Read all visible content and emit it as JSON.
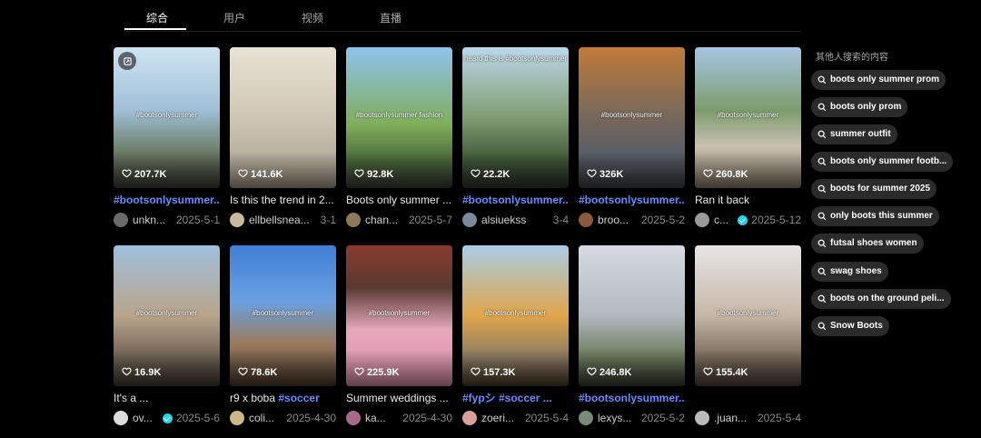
{
  "tabs": [
    "综合",
    "用户",
    "视频",
    "直播"
  ],
  "sidebar": {
    "title": "其他人搜索的内容",
    "suggestions": [
      "boots only summer prom",
      "boots only prom",
      "summer outfit",
      "boots only summer footb...",
      "boots for summer 2025",
      "only boots this summer",
      "futsal shoes women",
      "swag shoes",
      "boots on the ground peli...",
      "Snow Boots"
    ]
  },
  "colors": {
    "accent": "#6b8cff",
    "verified": "#20d5ec",
    "chip_bg": "#2b2b2b"
  },
  "videos": [
    {
      "likes": "207.7K",
      "title": "",
      "tag": "#bootsonlysummer...",
      "author": "unkn...",
      "date": "2025-5-1",
      "caption": "#bootsonlysummer",
      "bg": "linear-gradient(180deg,#cfe4f3 0%,#9fbfd6 45%,#6b7a64 75%,#3b3b33 100%)",
      "avatar": "#6b6b6b"
    },
    {
      "likes": "141.6K",
      "title": "Is this the trend in 2...",
      "tag": "",
      "author": "ellbellsnea...",
      "date": "3-1",
      "caption": "",
      "bg": "linear-gradient(180deg,#e9e3d6 0%,#cfc6b2 50%,#a59c8a 100%)",
      "avatar": "#c9b9a1"
    },
    {
      "likes": "92.8K",
      "title": "Boots only summer ...",
      "tag": "",
      "author": "chan...",
      "date": "2025-5-7",
      "caption": "#bootsonlysummer  fashion",
      "bg": "linear-gradient(180deg,#8fc3ee 0%,#7fae5c 55%,#4c6b3a 80%,#3a3a32 100%)",
      "avatar": "#8d7a5a"
    },
    {
      "likes": "22.2K",
      "title": "",
      "tag": "#bootsonlysummer...",
      "author": "alsiuekss",
      "date": "3-4",
      "caption": "heard this is #bootsonlysummer",
      "bg": "linear-gradient(180deg,#bcd7ea 0%,#7e9c73 50%,#405a36 80%,#2e2e2e 100%)",
      "avatar": "#7a8a9a"
    },
    {
      "likes": "326K",
      "title": "",
      "tag": "#bootsonlysummer...",
      "author": "broo...",
      "date": "2025-5-2",
      "caption": "#bootsonlysummer",
      "bg": "linear-gradient(180deg,#c37a3a 0%,#7c6a58 45%,#5a5e66 75%,#3c3f45 100%)",
      "avatar": "#8a5a3a"
    },
    {
      "likes": "260.8K",
      "title": "Ran it back",
      "tag": "",
      "author": "c...",
      "date": "2025-5-12",
      "caption": "#bootsonlysummer",
      "bg": "linear-gradient(180deg,#a6c6e4 0%,#7c9c6c 45%,#c9c0b0 70%,#8a7c6a 100%)",
      "avatar": "#9a9a9a",
      "verified": true
    },
    {
      "likes": "16.9K",
      "title": "It's a ...",
      "tag": "",
      "author": "ov...",
      "date": "2025-5-6",
      "caption": "#bootsonlysummer",
      "bg": "linear-gradient(180deg,#9fc0dd 0%,#b9a48a 50%,#6f6252 80%,#3f3a33 100%)",
      "avatar": "#dddddd",
      "verified": true
    },
    {
      "likes": "78.6K",
      "title": "r9 x boba ",
      "tag": "#soccer",
      "author": "coli...",
      "date": "2025-4-30",
      "caption": "#bootsonlysummer",
      "bg": "linear-gradient(180deg,#3f7fd6 0%,#6aa0e0 40%,#9a7a5e 70%,#4a3a2e 100%)",
      "avatar": "#c9b98a"
    },
    {
      "likes": "225.9K",
      "title": "Summer weddings ...",
      "tag": "",
      "author": "ka...",
      "date": "2025-4-30",
      "caption": "#bootsonlysummer",
      "bg": "linear-gradient(180deg,#8a3a2e 0%,#5a3a32 30%,#e7a9bd 60%,#d98aa6 100%)",
      "avatar": "#a86a8a"
    },
    {
      "likes": "157.3K",
      "title": "",
      "tag": "#fypシ #soccer ...",
      "author": "zoeri...",
      "date": "2025-5-4",
      "caption": "#bootsonlysummer",
      "bg": "linear-gradient(180deg,#a8cde6 0%,#e0a64a 50%,#8a7a62 80%,#4a3a2a 100%)",
      "avatar": "#d9a09a"
    },
    {
      "likes": "246.8K",
      "title": "",
      "tag": "#bootsonlysummer...",
      "author": "lexys...",
      "date": "2025-5-2",
      "caption": "",
      "bg": "linear-gradient(180deg,#d7dbe0 0%,#b3b8be 50%,#6a7a5a 80%,#3a3a34 100%)",
      "avatar": "#7a8a7a"
    },
    {
      "likes": "155.4K",
      "title": "",
      "tag": "",
      "author": ".juan...",
      "date": "2025-5-4",
      "caption": "#bootsonlysummer",
      "bg": "linear-gradient(180deg,#e6e6e6 0%,#c6b6a6 50%,#7a6a5a 80%,#4a4036 100%)",
      "avatar": "#bababa"
    }
  ]
}
